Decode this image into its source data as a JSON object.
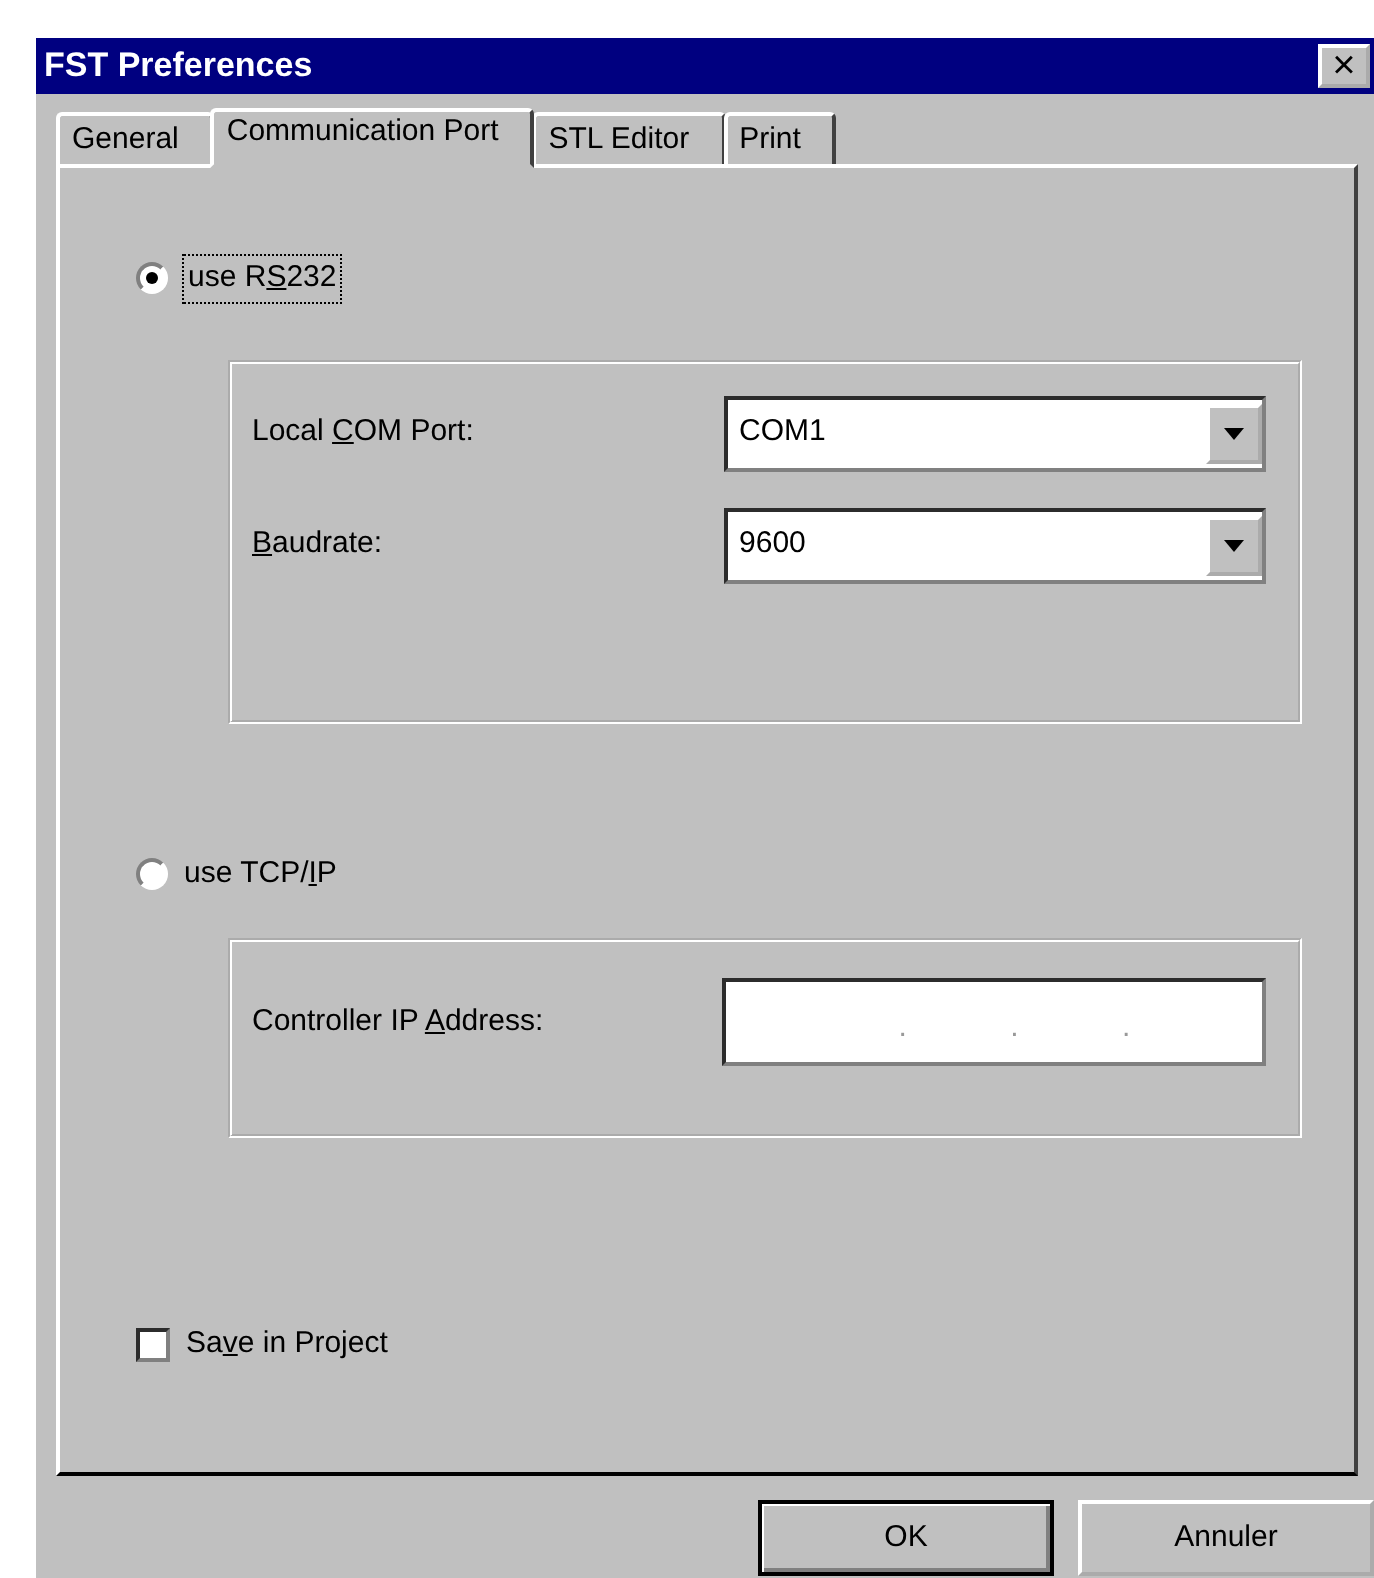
{
  "window": {
    "title": "FST Preferences",
    "close": "×"
  },
  "tabs": [
    {
      "label": "General",
      "selected": false
    },
    {
      "label": "Communication Port",
      "selected": true
    },
    {
      "label": "STL Editor",
      "selected": false
    },
    {
      "label": "Print",
      "selected": false
    }
  ],
  "options": [
    {
      "label": {
        "before": "use R",
        "key": "S",
        "after": "232"
      },
      "selected": true,
      "focused": true,
      "fields": [
        {
          "label": {
            "before": "Local ",
            "key": "C",
            "after": "OM Port:"
          },
          "kind": "dropdown",
          "value": "COM1"
        },
        {
          "label": {
            "key": "B",
            "after": "audrate:"
          },
          "kind": "dropdown",
          "value": "9600"
        }
      ]
    },
    {
      "label": {
        "before": "use TCP/",
        "key": "I",
        "after": "P"
      },
      "selected": false,
      "focused": false,
      "fields": [
        {
          "label": {
            "before": "Controller IP ",
            "key": "A",
            "after": "ddress:"
          },
          "kind": "ip",
          "separators": [
            ".",
            ".",
            "."
          ]
        }
      ]
    }
  ],
  "save_in_project": {
    "label": {
      "before": "Sa",
      "key": "v",
      "after": "e in Project"
    },
    "checked": false
  },
  "buttons": [
    {
      "label": "OK",
      "default": true
    },
    {
      "label": "Annuler",
      "default": false
    }
  ]
}
